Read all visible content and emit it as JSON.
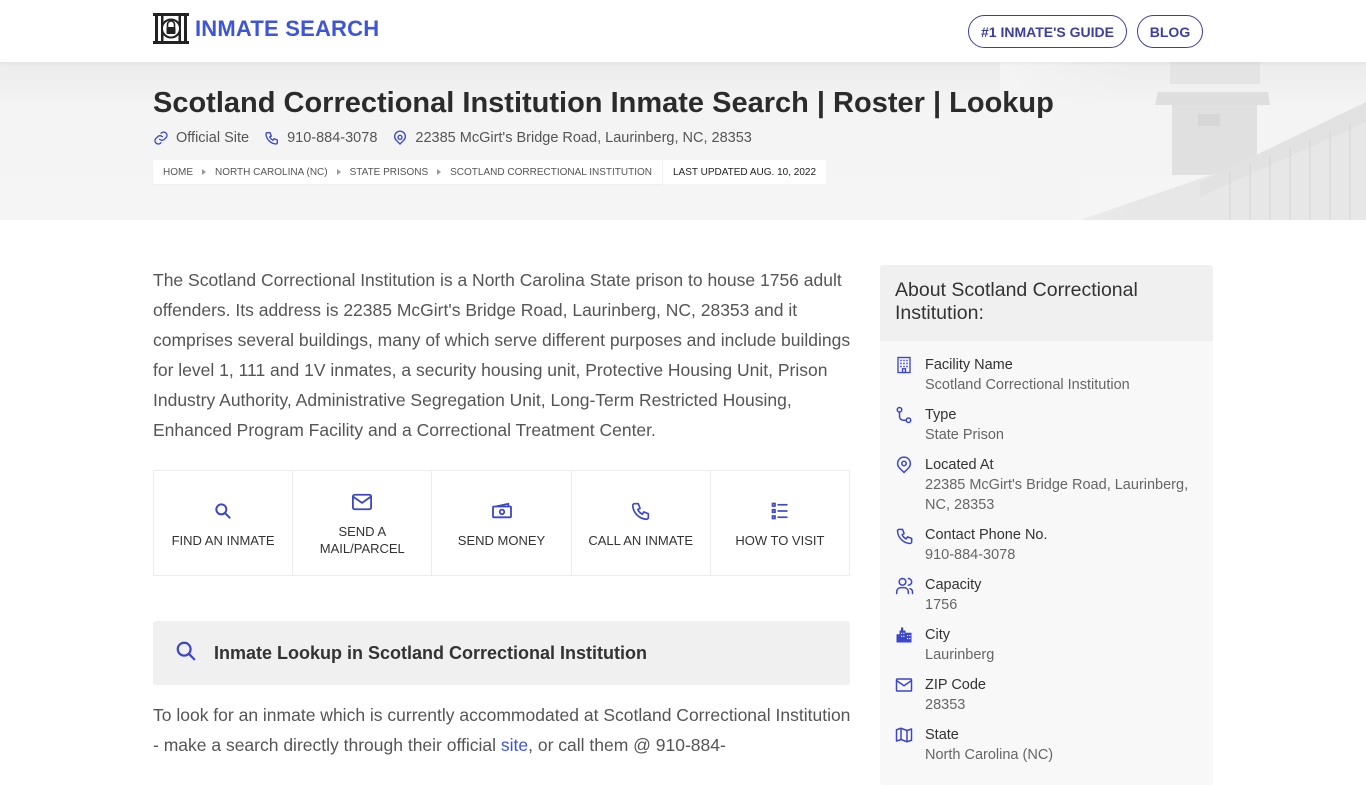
{
  "header": {
    "logo_text": "INMATE SEARCH",
    "nav": [
      {
        "label": "#1 INMATE'S GUIDE"
      },
      {
        "label": "BLOG"
      }
    ]
  },
  "hero": {
    "title": "Scotland Correctional Institution Inmate Search | Roster | Lookup",
    "official_site": "Official Site",
    "phone": "910-884-3078",
    "address": "22385 McGirt's Bridge Road, Laurinberg, NC, 28353",
    "breadcrumbs": [
      "HOME",
      "NORTH CAROLINA (NC)",
      "STATE PRISONS",
      "SCOTLAND CORRECTIONAL INSTITUTION"
    ],
    "last_updated": "LAST UPDATED AUG. 10, 2022"
  },
  "intro": "The Scotland Correctional Institution is a North Carolina State prison to house 1756 adult offenders. Its address is 22385 McGirt's Bridge Road, Laurinberg, NC, 28353 and it comprises several buildings, many of which serve different purposes and include buildings for level 1, 111 and 1V inmates, a security housing unit, Protective Housing Unit, Prison Industry Authority, Administrative Segregation Unit, Long-Term Restricted Housing, Enhanced Program Facility and a Correctional Treatment Center.",
  "actions": [
    {
      "label": "FIND AN INMATE",
      "icon": "search-icon"
    },
    {
      "label": "SEND A MAIL/PARCEL",
      "icon": "mail-icon"
    },
    {
      "label": "SEND MONEY",
      "icon": "money-icon"
    },
    {
      "label": "CALL AN INMATE",
      "icon": "phone-icon"
    },
    {
      "label": "HOW TO VISIT",
      "icon": "list-icon"
    }
  ],
  "lookup": {
    "title": "Inmate Lookup in Scotland Correctional Institution",
    "text_before": "To look for an inmate which is currently accommodated at Scotland Correctional Institution - make a search directly through their official ",
    "link_text": "site",
    "text_after": ", or call them @ 910-884-"
  },
  "sidebar": {
    "title": "About Scotland Correctional Institution:",
    "items": [
      {
        "label": "Facility Name",
        "value": "Scotland Correctional Institution",
        "icon": "building-icon"
      },
      {
        "label": "Type",
        "value": "State Prison",
        "icon": "route-icon"
      },
      {
        "label": "Located At",
        "value": "22385 McGirt's Bridge Road, Laurinberg, NC, 28353",
        "icon": "location-pin-icon"
      },
      {
        "label": "Contact Phone No.",
        "value": "910-884-3078",
        "icon": "phone-icon"
      },
      {
        "label": "Capacity",
        "value": "1756",
        "icon": "users-icon"
      },
      {
        "label": "City",
        "value": "Laurinberg",
        "icon": "city-icon"
      },
      {
        "label": "ZIP Code",
        "value": "28353",
        "icon": "mail-icon"
      },
      {
        "label": "State",
        "value": "North Carolina (NC)",
        "icon": "map-icon"
      }
    ]
  },
  "colors": {
    "brand": "#3d55d7",
    "nav_border": "#3c3fa0",
    "icon": "#3c46c8"
  }
}
